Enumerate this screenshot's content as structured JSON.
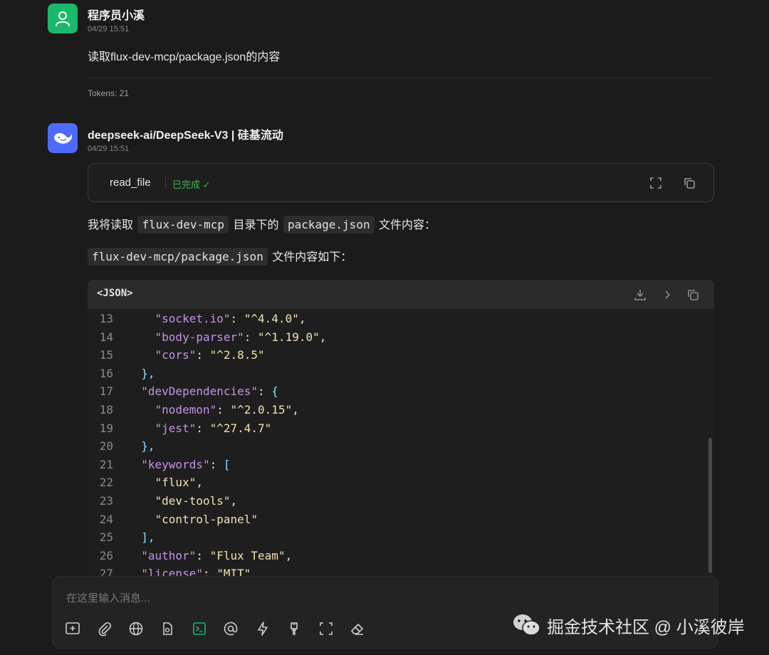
{
  "user_message": {
    "sender": "程序员小溪",
    "time": "04/29 15:51",
    "text": "读取flux-dev-mcp/package.json的内容",
    "tokens": "Tokens: 21"
  },
  "ai_message": {
    "sender": "deepseek-ai/DeepSeek-V3 | 硅基流动",
    "time": "04/29 15:51",
    "tool_call": {
      "name": "read_file",
      "status": "已完成 ✓"
    },
    "paragraph1": {
      "pre": "我将读取",
      "chip1": "flux-dev-mcp",
      "mid": "目录下的",
      "chip2": "package.json",
      "post": "文件内容："
    },
    "paragraph2": {
      "chip": "flux-dev-mcp/package.json",
      "post": "文件内容如下："
    },
    "code_block": {
      "language": "<JSON>",
      "lines": [
        {
          "n": "13",
          "indent": "    ",
          "key": "\"socket.io\"",
          "sep": ": ",
          "val": "\"^4.4.0\"",
          "end": ","
        },
        {
          "n": "14",
          "indent": "    ",
          "key": "\"body-parser\"",
          "sep": ": ",
          "val": "\"^1.19.0\"",
          "end": ","
        },
        {
          "n": "15",
          "indent": "    ",
          "key": "\"cors\"",
          "sep": ": ",
          "val": "\"^2.8.5\"",
          "end": ""
        },
        {
          "n": "16",
          "indent": "  ",
          "key": "",
          "sep": "",
          "val": "",
          "end": "},"
        },
        {
          "n": "17",
          "indent": "  ",
          "key": "\"devDependencies\"",
          "sep": ": ",
          "val": "",
          "end": "{"
        },
        {
          "n": "18",
          "indent": "    ",
          "key": "\"nodemon\"",
          "sep": ": ",
          "val": "\"^2.0.15\"",
          "end": ","
        },
        {
          "n": "19",
          "indent": "    ",
          "key": "\"jest\"",
          "sep": ": ",
          "val": "\"^27.4.7\"",
          "end": ""
        },
        {
          "n": "20",
          "indent": "  ",
          "key": "",
          "sep": "",
          "val": "",
          "end": "},"
        },
        {
          "n": "21",
          "indent": "  ",
          "key": "\"keywords\"",
          "sep": ": ",
          "val": "",
          "end": "["
        },
        {
          "n": "22",
          "indent": "    ",
          "key": "",
          "sep": "",
          "val": "\"flux\"",
          "end": ","
        },
        {
          "n": "23",
          "indent": "    ",
          "key": "",
          "sep": "",
          "val": "\"dev-tools\"",
          "end": ","
        },
        {
          "n": "24",
          "indent": "    ",
          "key": "",
          "sep": "",
          "val": "\"control-panel\"",
          "end": ""
        },
        {
          "n": "25",
          "indent": "  ",
          "key": "",
          "sep": "",
          "val": "",
          "end": "],"
        },
        {
          "n": "26",
          "indent": "  ",
          "key": "\"author\"",
          "sep": ": ",
          "val": "\"Flux Team\"",
          "end": ","
        },
        {
          "n": "27",
          "indent": "  ",
          "key": "\"license\"",
          "sep": ": ",
          "val": "\"MIT\"",
          "end": ""
        }
      ]
    }
  },
  "composer": {
    "placeholder": "在这里输入消息...",
    "tools": [
      "new-chat-icon",
      "attach-icon",
      "globe-icon",
      "file-icon",
      "terminal-icon",
      "mention-icon",
      "lightning-icon",
      "brush-icon",
      "fullscreen-icon",
      "eraser-icon"
    ]
  },
  "watermark": "掘金技术社区 @ 小溪彼岸",
  "colors": {
    "background": "#1b1b1b",
    "accent_green": "#19b86a",
    "deepseek_blue": "#4d6bfe",
    "status_green": "#3fb950",
    "json_key": "#c792ea",
    "json_string": "#f0e0b0"
  }
}
